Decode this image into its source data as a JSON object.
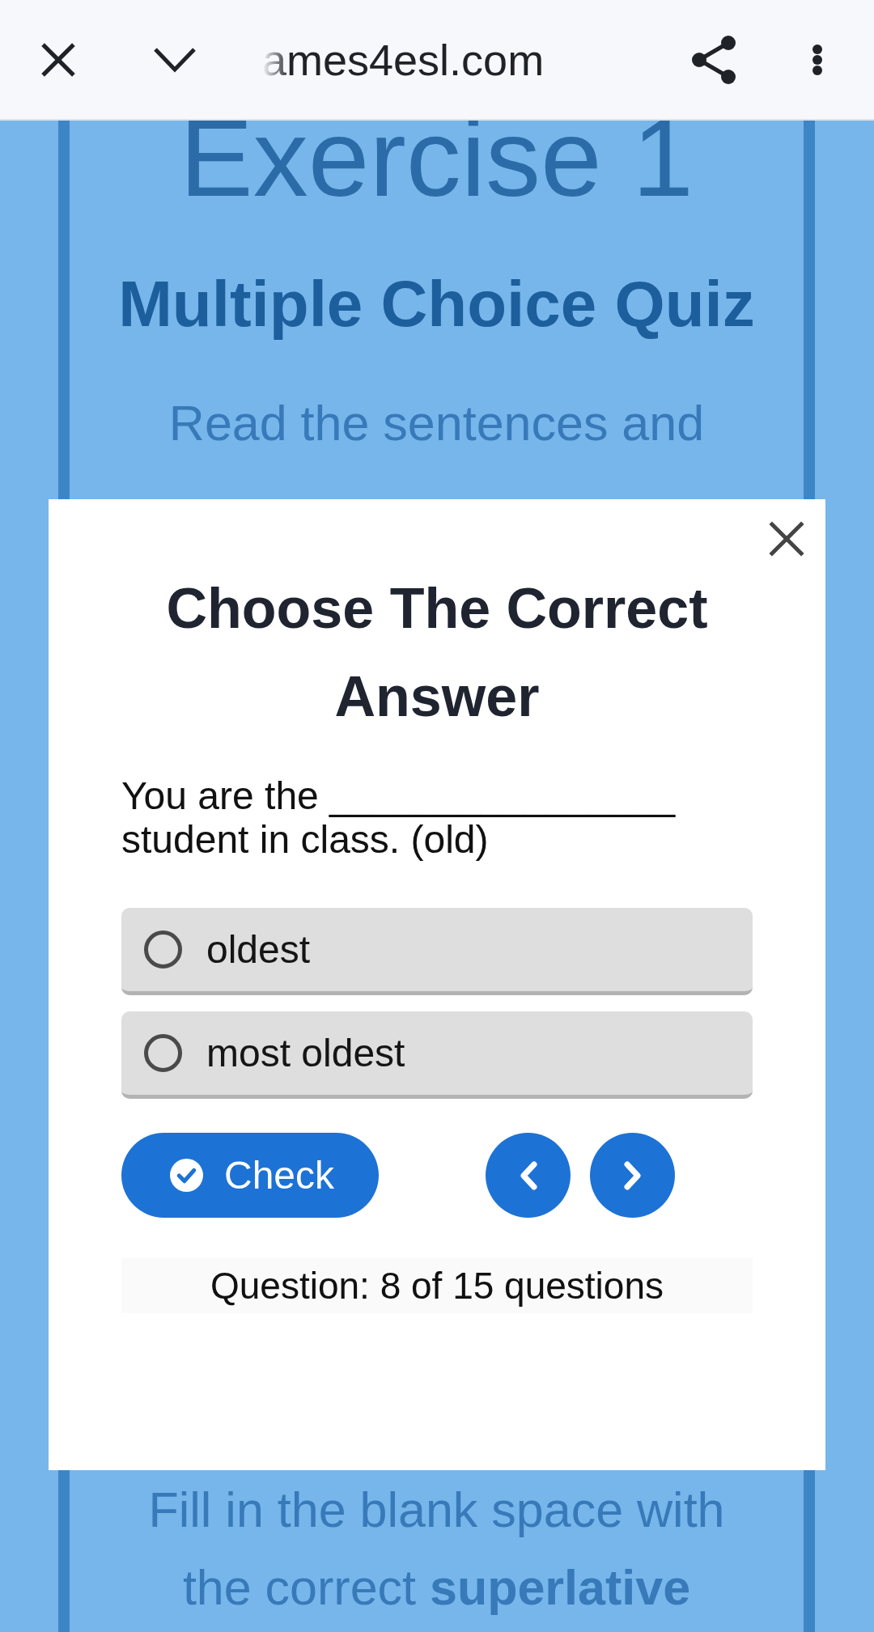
{
  "browser_bar": {
    "url": "ames4esl.com"
  },
  "page": {
    "heading": "Exercise 1",
    "subtitle": "Multiple Choice Quiz",
    "intro": "Read the sentences and",
    "instructions": "Fill in the blank space with the correct **superlative**"
  },
  "dialog": {
    "title": "Choose The Correct Answer",
    "question": "You are the ________________ student in class. (old)",
    "options": [
      {
        "label": "oldest",
        "selected": false
      },
      {
        "label": "most oldest",
        "selected": false
      }
    ],
    "check_button": "Check",
    "progress": "Question: 8 of 15 questions"
  }
}
